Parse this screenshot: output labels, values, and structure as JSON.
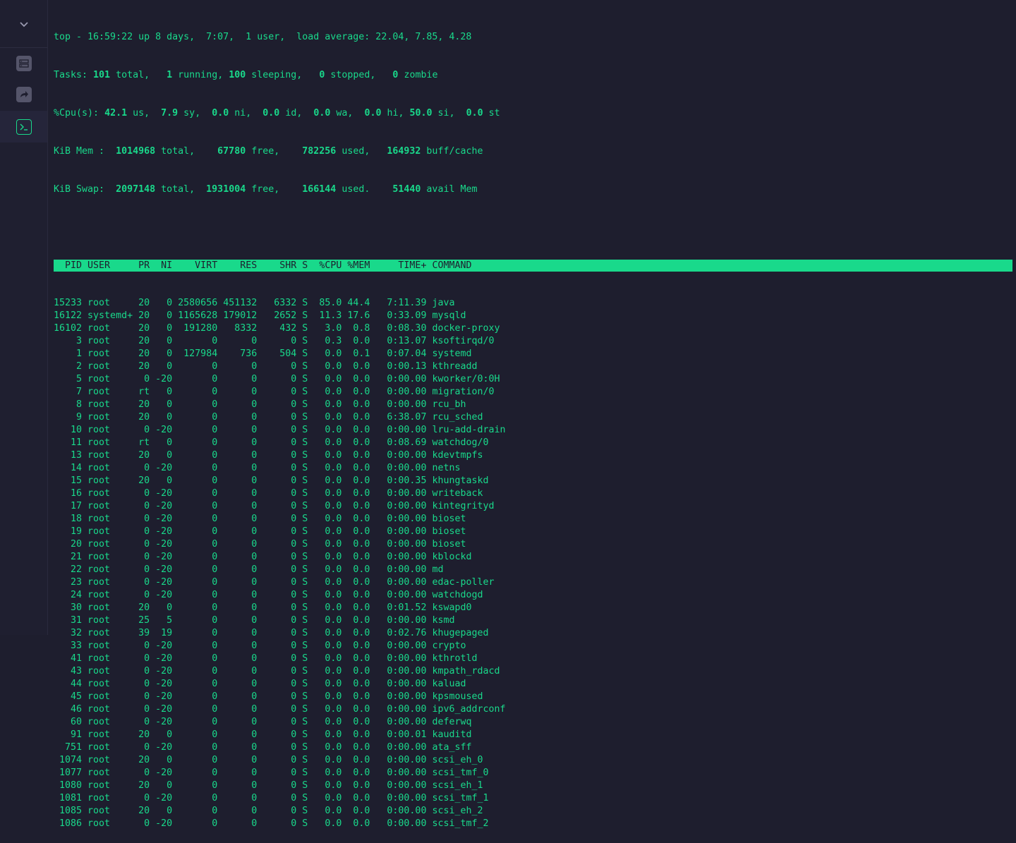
{
  "summary": {
    "uptime_line": "top - 16:59:22 up 8 days,  7:07,  1 user,  load average: 22.04, 7.85, 4.28",
    "tasks": {
      "prefix": "Tasks: ",
      "total": "101",
      "total_l": " total,   ",
      "running": "1",
      "running_l": " running, ",
      "sleeping": "100",
      "sleeping_l": " sleeping,   ",
      "stopped": "0",
      "stopped_l": " stopped,   ",
      "zombie": "0",
      "zombie_l": " zombie"
    },
    "cpu": {
      "prefix": "%Cpu(s): ",
      "us": "42.1",
      "us_l": " us,  ",
      "sy": "7.9",
      "sy_l": " sy,  ",
      "ni": "0.0",
      "ni_l": " ni,  ",
      "id": "0.0",
      "id_l": " id,  ",
      "wa": "0.0",
      "wa_l": " wa,  ",
      "hi": "0.0",
      "hi_l": " hi, ",
      "si": "50.0",
      "si_l": " si,  ",
      "st": "0.0",
      "st_l": " st"
    },
    "mem": {
      "prefix": "KiB Mem :  ",
      "total": "1014968",
      "total_l": " total,    ",
      "free": "67780",
      "free_l": " free,    ",
      "used": "782256",
      "used_l": " used,   ",
      "buff": "164932",
      "buff_l": " buff/cache"
    },
    "swap": {
      "prefix": "KiB Swap:  ",
      "total": "2097148",
      "total_l": " total,  ",
      "free": "1931004",
      "free_l": " free,    ",
      "used": "166144",
      "used_l": " used.    ",
      "avail": "51440",
      "avail_l": " avail Mem"
    }
  },
  "columns": [
    "PID",
    "USER",
    "PR",
    "NI",
    "VIRT",
    "RES",
    "SHR",
    "S",
    "%CPU",
    "%MEM",
    "TIME+",
    "COMMAND"
  ],
  "processes": [
    [
      "15233",
      "root",
      "20",
      "0",
      "2580656",
      "451132",
      "6332",
      "S",
      "85.0",
      "44.4",
      "7:11.39",
      "java"
    ],
    [
      "16122",
      "systemd+",
      "20",
      "0",
      "1165628",
      "179012",
      "2652",
      "S",
      "11.3",
      "17.6",
      "0:33.09",
      "mysqld"
    ],
    [
      "16102",
      "root",
      "20",
      "0",
      "191280",
      "8332",
      "432",
      "S",
      "3.0",
      "0.8",
      "0:08.30",
      "docker-proxy"
    ],
    [
      "3",
      "root",
      "20",
      "0",
      "0",
      "0",
      "0",
      "S",
      "0.3",
      "0.0",
      "0:13.07",
      "ksoftirqd/0"
    ],
    [
      "1",
      "root",
      "20",
      "0",
      "127984",
      "736",
      "504",
      "S",
      "0.0",
      "0.1",
      "0:07.04",
      "systemd"
    ],
    [
      "2",
      "root",
      "20",
      "0",
      "0",
      "0",
      "0",
      "S",
      "0.0",
      "0.0",
      "0:00.13",
      "kthreadd"
    ],
    [
      "5",
      "root",
      "0",
      "-20",
      "0",
      "0",
      "0",
      "S",
      "0.0",
      "0.0",
      "0:00.00",
      "kworker/0:0H"
    ],
    [
      "7",
      "root",
      "rt",
      "0",
      "0",
      "0",
      "0",
      "S",
      "0.0",
      "0.0",
      "0:00.00",
      "migration/0"
    ],
    [
      "8",
      "root",
      "20",
      "0",
      "0",
      "0",
      "0",
      "S",
      "0.0",
      "0.0",
      "0:00.00",
      "rcu_bh"
    ],
    [
      "9",
      "root",
      "20",
      "0",
      "0",
      "0",
      "0",
      "S",
      "0.0",
      "0.0",
      "6:38.07",
      "rcu_sched"
    ],
    [
      "10",
      "root",
      "0",
      "-20",
      "0",
      "0",
      "0",
      "S",
      "0.0",
      "0.0",
      "0:00.00",
      "lru-add-drain"
    ],
    [
      "11",
      "root",
      "rt",
      "0",
      "0",
      "0",
      "0",
      "S",
      "0.0",
      "0.0",
      "0:08.69",
      "watchdog/0"
    ],
    [
      "13",
      "root",
      "20",
      "0",
      "0",
      "0",
      "0",
      "S",
      "0.0",
      "0.0",
      "0:00.00",
      "kdevtmpfs"
    ],
    [
      "14",
      "root",
      "0",
      "-20",
      "0",
      "0",
      "0",
      "S",
      "0.0",
      "0.0",
      "0:00.00",
      "netns"
    ],
    [
      "15",
      "root",
      "20",
      "0",
      "0",
      "0",
      "0",
      "S",
      "0.0",
      "0.0",
      "0:00.35",
      "khungtaskd"
    ],
    [
      "16",
      "root",
      "0",
      "-20",
      "0",
      "0",
      "0",
      "S",
      "0.0",
      "0.0",
      "0:00.00",
      "writeback"
    ],
    [
      "17",
      "root",
      "0",
      "-20",
      "0",
      "0",
      "0",
      "S",
      "0.0",
      "0.0",
      "0:00.00",
      "kintegrityd"
    ],
    [
      "18",
      "root",
      "0",
      "-20",
      "0",
      "0",
      "0",
      "S",
      "0.0",
      "0.0",
      "0:00.00",
      "bioset"
    ],
    [
      "19",
      "root",
      "0",
      "-20",
      "0",
      "0",
      "0",
      "S",
      "0.0",
      "0.0",
      "0:00.00",
      "bioset"
    ],
    [
      "20",
      "root",
      "0",
      "-20",
      "0",
      "0",
      "0",
      "S",
      "0.0",
      "0.0",
      "0:00.00",
      "bioset"
    ],
    [
      "21",
      "root",
      "0",
      "-20",
      "0",
      "0",
      "0",
      "S",
      "0.0",
      "0.0",
      "0:00.00",
      "kblockd"
    ],
    [
      "22",
      "root",
      "0",
      "-20",
      "0",
      "0",
      "0",
      "S",
      "0.0",
      "0.0",
      "0:00.00",
      "md"
    ],
    [
      "23",
      "root",
      "0",
      "-20",
      "0",
      "0",
      "0",
      "S",
      "0.0",
      "0.0",
      "0:00.00",
      "edac-poller"
    ],
    [
      "24",
      "root",
      "0",
      "-20",
      "0",
      "0",
      "0",
      "S",
      "0.0",
      "0.0",
      "0:00.00",
      "watchdogd"
    ],
    [
      "30",
      "root",
      "20",
      "0",
      "0",
      "0",
      "0",
      "S",
      "0.0",
      "0.0",
      "0:01.52",
      "kswapd0"
    ],
    [
      "31",
      "root",
      "25",
      "5",
      "0",
      "0",
      "0",
      "S",
      "0.0",
      "0.0",
      "0:00.00",
      "ksmd"
    ],
    [
      "32",
      "root",
      "39",
      "19",
      "0",
      "0",
      "0",
      "S",
      "0.0",
      "0.0",
      "0:02.76",
      "khugepaged"
    ],
    [
      "33",
      "root",
      "0",
      "-20",
      "0",
      "0",
      "0",
      "S",
      "0.0",
      "0.0",
      "0:00.00",
      "crypto"
    ],
    [
      "41",
      "root",
      "0",
      "-20",
      "0",
      "0",
      "0",
      "S",
      "0.0",
      "0.0",
      "0:00.00",
      "kthrotld"
    ],
    [
      "43",
      "root",
      "0",
      "-20",
      "0",
      "0",
      "0",
      "S",
      "0.0",
      "0.0",
      "0:00.00",
      "kmpath_rdacd"
    ],
    [
      "44",
      "root",
      "0",
      "-20",
      "0",
      "0",
      "0",
      "S",
      "0.0",
      "0.0",
      "0:00.00",
      "kaluad"
    ],
    [
      "45",
      "root",
      "0",
      "-20",
      "0",
      "0",
      "0",
      "S",
      "0.0",
      "0.0",
      "0:00.00",
      "kpsmoused"
    ],
    [
      "46",
      "root",
      "0",
      "-20",
      "0",
      "0",
      "0",
      "S",
      "0.0",
      "0.0",
      "0:00.00",
      "ipv6_addrconf"
    ],
    [
      "60",
      "root",
      "0",
      "-20",
      "0",
      "0",
      "0",
      "S",
      "0.0",
      "0.0",
      "0:00.00",
      "deferwq"
    ],
    [
      "91",
      "root",
      "20",
      "0",
      "0",
      "0",
      "0",
      "S",
      "0.0",
      "0.0",
      "0:00.01",
      "kauditd"
    ],
    [
      "751",
      "root",
      "0",
      "-20",
      "0",
      "0",
      "0",
      "S",
      "0.0",
      "0.0",
      "0:00.00",
      "ata_sff"
    ],
    [
      "1074",
      "root",
      "20",
      "0",
      "0",
      "0",
      "0",
      "S",
      "0.0",
      "0.0",
      "0:00.00",
      "scsi_eh_0"
    ],
    [
      "1077",
      "root",
      "0",
      "-20",
      "0",
      "0",
      "0",
      "S",
      "0.0",
      "0.0",
      "0:00.00",
      "scsi_tmf_0"
    ],
    [
      "1080",
      "root",
      "20",
      "0",
      "0",
      "0",
      "0",
      "S",
      "0.0",
      "0.0",
      "0:00.00",
      "scsi_eh_1"
    ],
    [
      "1081",
      "root",
      "0",
      "-20",
      "0",
      "0",
      "0",
      "S",
      "0.0",
      "0.0",
      "0:00.00",
      "scsi_tmf_1"
    ],
    [
      "1085",
      "root",
      "20",
      "0",
      "0",
      "0",
      "0",
      "S",
      "0.0",
      "0.0",
      "0:00.00",
      "scsi_eh_2"
    ],
    [
      "1086",
      "root",
      "0",
      "-20",
      "0",
      "0",
      "0",
      "S",
      "0.0",
      "0.0",
      "0:00.00",
      "scsi_tmf_2"
    ]
  ],
  "sidebar": {
    "items": [
      {
        "icon": "chevron-down-icon"
      },
      {
        "icon": "server-icon"
      },
      {
        "icon": "share-forward-icon"
      },
      {
        "icon": "terminal-icon",
        "active": true
      }
    ]
  },
  "colors": {
    "terminal_fg": "#19d98b",
    "background": "#1e1e2e",
    "sidebar_bg": "#1f1f30"
  }
}
